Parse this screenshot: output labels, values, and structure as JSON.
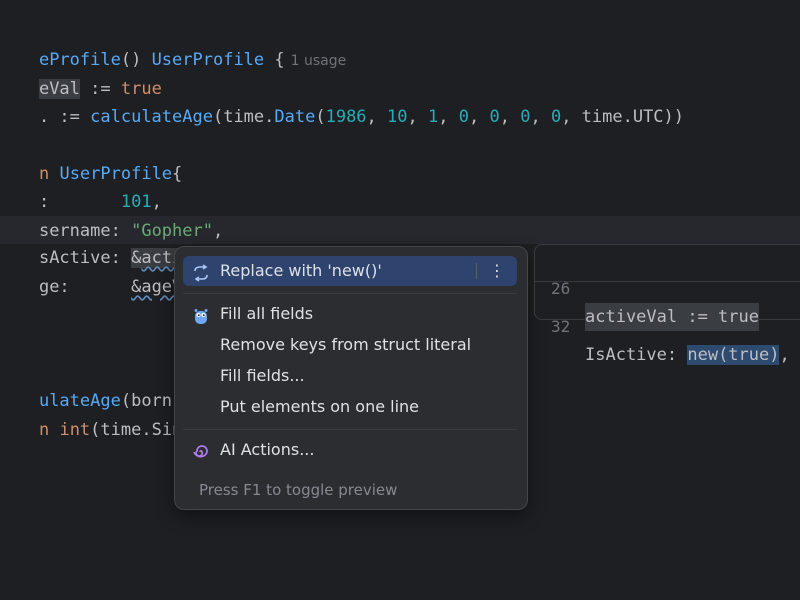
{
  "editor": {
    "line1": {
      "fn": "eProfile",
      "paren": "() ",
      "type": "UserProfile",
      "brace": " {",
      "usage": "1 usage"
    },
    "line2": {
      "var": "eVal",
      "op": " := ",
      "val": "true"
    },
    "line3": {
      "pre": ". := ",
      "fn": "calculateAge",
      "open": "(time.",
      "fn2": "Date",
      "args_open": "(",
      "n1": "1986",
      "c1": ", ",
      "n2": "10",
      "c2": ", ",
      "n3": "1",
      "c3": ", ",
      "n4": "0",
      "c4": ", ",
      "n5": "0",
      "c5": ", ",
      "n6": "0",
      "c6": ", ",
      "n7": "0",
      "c7": ", time.UTC))"
    },
    "line4": {
      "kw": "n",
      "space": " ",
      "type": "UserProfile",
      "brace": "{"
    },
    "line5": {
      "key": ":",
      "pad": "       ",
      "num": "101",
      "comma": ","
    },
    "line6": {
      "key": "sername:",
      "space": " ",
      "str": "\"Gopher\"",
      "comma": ","
    },
    "line7": {
      "key": "sActive:",
      "space": " ",
      "amp": "&",
      "var": "activeVal",
      "comma": ","
    },
    "line8": {
      "key": "ge:",
      "pad": "      ",
      "ref": "&ageVal",
      "comma": ","
    },
    "line9": {
      "fn": "ulateAge",
      "rest": "(born time"
    },
    "line10": {
      "kw": "n",
      "space": " ",
      "fn": "int",
      "rest": "(time.Since(b"
    }
  },
  "popup": {
    "items": [
      {
        "label": "Replace with 'new()'",
        "icon": "replace-icon"
      },
      {
        "label": "Fill all fields",
        "icon": "gopher-icon"
      },
      {
        "label": "Remove keys from struct literal"
      },
      {
        "label": "Fill fields..."
      },
      {
        "label": "Put elements on one line"
      },
      {
        "label": "AI Actions...",
        "icon": "ai-spiral-icon"
      }
    ],
    "more": "⋮",
    "footer": "Press F1 to toggle preview"
  },
  "preview": {
    "row1": {
      "num": "26",
      "code": "activeVal := true"
    },
    "row2": {
      "num": "32",
      "key": "IsActive: ",
      "new": "new(true)",
      "tail": ","
    }
  },
  "colors": {
    "background": "#1e1f22",
    "function": "#57aaf7",
    "keyword": "#cf8e6d",
    "number": "#2aacb8",
    "string": "#6aab73",
    "selection": "#2e436e"
  }
}
